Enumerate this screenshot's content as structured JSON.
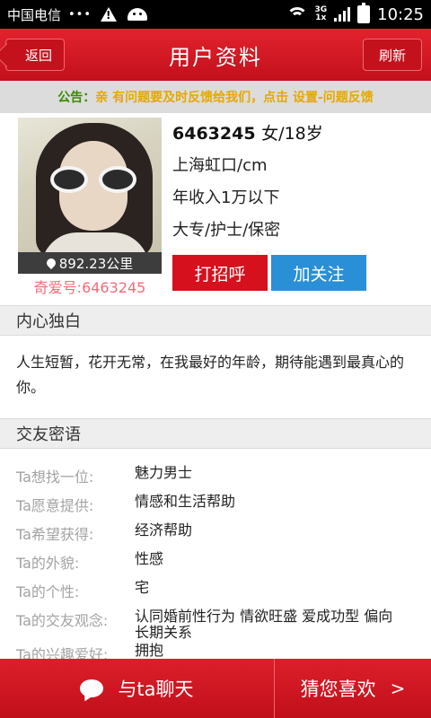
{
  "statusbar": {
    "carrier": "中国电信",
    "dots": "•••",
    "network": "3G\n1x",
    "time": "10:25"
  },
  "header": {
    "title": "用户资料",
    "back_label": "返回",
    "refresh_label": "刷新"
  },
  "notice": {
    "label": "公告：",
    "message": "亲 有问题要及时反馈给我们，点击 设置-问题反馈"
  },
  "profile": {
    "id": "6463245",
    "gender_age": "女/18岁",
    "location_height": "上海虹口/cm",
    "income": "年收入1万以下",
    "edu_job": "大专/护士/保密",
    "distance": "892.23公里",
    "qiai_id": "奇爱号:6463245",
    "greet_label": "打招呼",
    "follow_label": "加关注"
  },
  "monologue": {
    "heading": "内心独白",
    "text": "人生短暂，花开无常，在我最好的年龄，期待能遇到最真心的你。"
  },
  "dating": {
    "heading": "交友密语",
    "items": [
      {
        "key": "Ta想找一位:",
        "value": "魅力男士"
      },
      {
        "key": "Ta愿意提供:",
        "value": "情感和生活帮助"
      },
      {
        "key": "Ta希望获得:",
        "value": "经济帮助"
      },
      {
        "key": "Ta的外貌:",
        "value": "性感"
      },
      {
        "key": "Ta的个性:",
        "value": "宅"
      },
      {
        "key": "Ta的交友观念:",
        "value": "认同婚前性行为 情欲旺盛 爱成功型 偏向长期关系"
      },
      {
        "key": "Ta的兴趣爱好:",
        "value": "拥抱"
      }
    ]
  },
  "bottom": {
    "chat_label": "与ta聊天",
    "guess_label": "猜您喜欢",
    "guess_chevron": ">"
  },
  "colors": {
    "accent": "#d7101d",
    "follow": "#2990d8",
    "notice_label": "#3a8a00",
    "notice_text": "#e6a800",
    "id_pink": "#f46b78"
  }
}
